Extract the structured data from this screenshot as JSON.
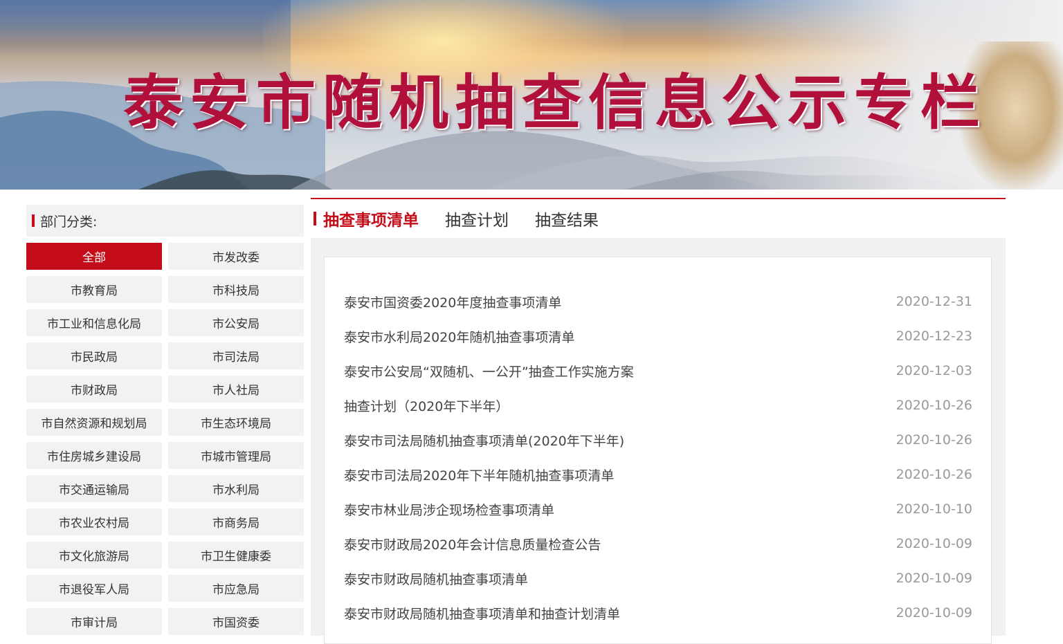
{
  "banner": {
    "title": "泰安市随机抽查信息公示专栏"
  },
  "sidebar": {
    "heading": "部门分类:",
    "categories": [
      "全部",
      "市发改委",
      "市教育局",
      "市科技局",
      "市工业和信息化局",
      "市公安局",
      "市民政局",
      "市司法局",
      "市财政局",
      "市人社局",
      "市自然资源和规划局",
      "市生态环境局",
      "市住房城乡建设局",
      "市城市管理局",
      "市交通运输局",
      "市水利局",
      "市农业农村局",
      "市商务局",
      "市文化旅游局",
      "市卫生健康委",
      "市退役军人局",
      "市应急局",
      "市审计局",
      "市国资委"
    ],
    "active_index": 0
  },
  "tabs": [
    "抽查事项清单",
    "抽查计划",
    "抽查结果"
  ],
  "active_tab": 0,
  "items": [
    {
      "title": "泰安市国资委2020年度抽查事项清单",
      "date": "2020-12-31"
    },
    {
      "title": "泰安市水利局2020年随机抽查事项清单",
      "date": "2020-12-23"
    },
    {
      "title": "泰安市公安局“双随机、一公开”抽查工作实施方案",
      "date": "2020-12-03"
    },
    {
      "title": "抽查计划（2020年下半年）",
      "date": "2020-10-26"
    },
    {
      "title": "泰安市司法局随机抽查事项清单(2020年下半年)",
      "date": "2020-10-26"
    },
    {
      "title": "泰安市司法局2020年下半年随机抽查事项清单",
      "date": "2020-10-26"
    },
    {
      "title": "泰安市林业局涉企现场检查事项清单",
      "date": "2020-10-10"
    },
    {
      "title": "泰安市财政局2020年会计信息质量检查公告",
      "date": "2020-10-09"
    },
    {
      "title": "泰安市财政局随机抽查事项清单",
      "date": "2020-10-09"
    },
    {
      "title": "泰安市财政局随机抽查事项清单和抽查计划清单",
      "date": "2020-10-09"
    }
  ],
  "colors": {
    "accent": "#c40d18",
    "title": "#b0103a"
  }
}
